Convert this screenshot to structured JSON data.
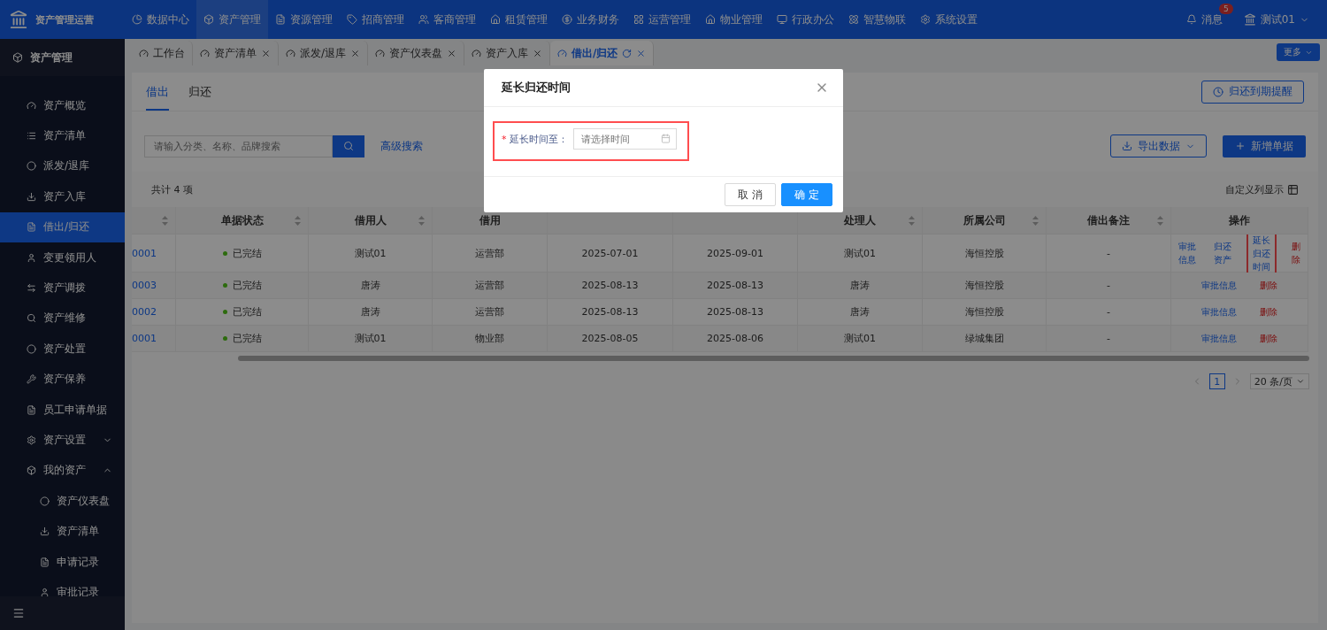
{
  "app": {
    "title": "资产管理运营"
  },
  "top_nav": [
    {
      "label": "数据中心",
      "selected": false
    },
    {
      "label": "资产管理",
      "selected": true
    },
    {
      "label": "资源管理",
      "selected": false
    },
    {
      "label": "招商管理",
      "selected": false
    },
    {
      "label": "客商管理",
      "selected": false
    },
    {
      "label": "租赁管理",
      "selected": false
    },
    {
      "label": "业务财务",
      "selected": false
    },
    {
      "label": "运营管理",
      "selected": false
    },
    {
      "label": "物业管理",
      "selected": false
    },
    {
      "label": "行政办公",
      "selected": false
    },
    {
      "label": "智慧物联",
      "selected": false
    },
    {
      "label": "系统设置",
      "selected": false
    }
  ],
  "messages": {
    "label": "消息",
    "badge": "5"
  },
  "user": {
    "name": "测试01"
  },
  "sidebar": {
    "title": "资产管理",
    "items": [
      {
        "label": "资产概览",
        "selected": false
      },
      {
        "label": "资产清单",
        "selected": false
      },
      {
        "label": "派发/退库",
        "selected": false
      },
      {
        "label": "资产入库",
        "selected": false
      },
      {
        "label": "借出/归还",
        "selected": true
      },
      {
        "label": "变更领用人",
        "selected": false
      },
      {
        "label": "资产调拨",
        "selected": false
      },
      {
        "label": "资产维修",
        "selected": false
      },
      {
        "label": "资产处置",
        "selected": false
      },
      {
        "label": "资产保养",
        "selected": false
      },
      {
        "label": "员工申请单据",
        "selected": false
      },
      {
        "label": "资产设置",
        "selected": false,
        "expanded": false
      },
      {
        "label": "我的资产",
        "selected": false,
        "expanded": true,
        "children": [
          {
            "label": "资产仪表盘",
            "selected": false
          },
          {
            "label": "资产清单",
            "selected": false
          },
          {
            "label": "申请记录",
            "selected": false
          },
          {
            "label": "审批记录",
            "selected": false
          }
        ]
      }
    ]
  },
  "page_tabs": [
    {
      "label": "工作台",
      "selected": false,
      "closable": false
    },
    {
      "label": "资产清单",
      "selected": false,
      "closable": true
    },
    {
      "label": "派发/退库",
      "selected": false,
      "closable": true
    },
    {
      "label": "资产仪表盘",
      "selected": false,
      "closable": true
    },
    {
      "label": "资产入库",
      "selected": false,
      "closable": true
    },
    {
      "label": "借出/归还",
      "selected": true,
      "closable": true
    }
  ],
  "more_button": "更多",
  "sub_tabs": [
    {
      "label": "借出",
      "selected": true
    },
    {
      "label": "归还",
      "selected": false
    }
  ],
  "reminder_button": "归还到期提醒",
  "search": {
    "placeholder": "请输入分类、名称、品牌搜索"
  },
  "advanced_search": "高级搜索",
  "export_button": "导出数据",
  "new_button": "新增单据",
  "total": "共计 4 项",
  "custom_columns": "自定义列显示",
  "table": {
    "columns": [
      {
        "sortable": true
      },
      {
        "label": "单据状态",
        "sortable": true
      },
      {
        "label": "借用人",
        "sortable": true
      },
      {
        "label": "借用"
      },
      {},
      {},
      {
        "label": "处理人",
        "sortable": true
      },
      {
        "label": "所属公司",
        "sortable": true
      },
      {
        "label": "借出备注",
        "sortable": true
      },
      {
        "label": "操作"
      }
    ],
    "rows": [
      {
        "cells": [
          "0001",
          "已完结",
          "测试01",
          "运营部",
          "2025-07-01",
          "2025-09-01",
          "测试01",
          "海恒控股",
          "-"
        ],
        "actions": [
          {
            "label": "审批信息",
            "kind": "link"
          },
          {
            "label": "归还资产",
            "kind": "link"
          },
          {
            "label": "延长归还时间",
            "kind": "link",
            "highlighted": true
          },
          {
            "label": "删除",
            "kind": "danger"
          }
        ]
      },
      {
        "cells": [
          "0003",
          "已完结",
          "唐涛",
          "运营部",
          "2025-08-13",
          "2025-08-13",
          "唐涛",
          "海恒控股",
          "-"
        ],
        "actions": [
          {
            "label": "审批信息",
            "kind": "link"
          },
          {
            "label": "删除",
            "kind": "danger"
          }
        ]
      },
      {
        "cells": [
          "0002",
          "已完结",
          "唐涛",
          "运营部",
          "2025-08-13",
          "2025-08-13",
          "唐涛",
          "海恒控股",
          "-"
        ],
        "actions": [
          {
            "label": "审批信息",
            "kind": "link"
          },
          {
            "label": "删除",
            "kind": "danger"
          }
        ]
      },
      {
        "cells": [
          "0001",
          "已完结",
          "测试01",
          "物业部",
          "2025-08-05",
          "2025-08-06",
          "测试01",
          "绿城集团",
          "-"
        ],
        "actions": [
          {
            "label": "审批信息",
            "kind": "link"
          },
          {
            "label": "删除",
            "kind": "danger"
          }
        ]
      }
    ]
  },
  "pagination": {
    "current": "1",
    "page_size": "20 条/页"
  },
  "modal": {
    "title": "延长归还时间",
    "field": {
      "required_mark": "*",
      "label": "延长时间至：",
      "placeholder": "请选择时间",
      "highlighted": true
    },
    "buttons": [
      {
        "label": "取 消",
        "kind": "default"
      },
      {
        "label": "确 定",
        "kind": "primary"
      }
    ]
  }
}
